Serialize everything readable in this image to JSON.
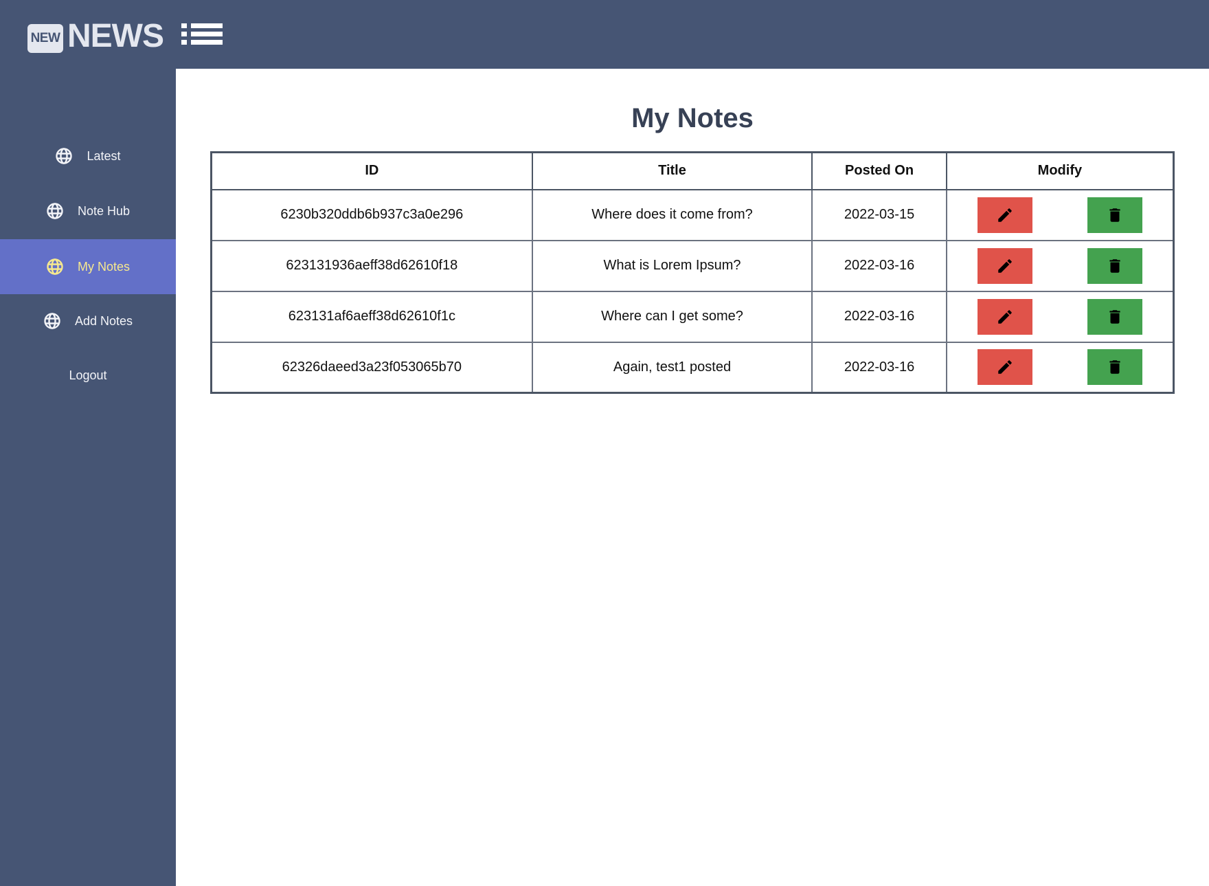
{
  "header": {
    "logo_badge": "NEW",
    "logo_text": "NEWS",
    "menu_icon": "list-menu-icon"
  },
  "sidebar": {
    "items": [
      {
        "label": "Latest",
        "icon": "globe-icon",
        "active": false
      },
      {
        "label": "Note Hub",
        "icon": "globe-icon",
        "active": false
      },
      {
        "label": "My Notes",
        "icon": "globe-icon",
        "active": true
      },
      {
        "label": "Add Notes",
        "icon": "globe-icon",
        "active": false
      },
      {
        "label": "Logout",
        "icon": null,
        "active": false
      }
    ]
  },
  "main": {
    "title": "My Notes",
    "table": {
      "headers": [
        "ID",
        "Title",
        "Posted On",
        "Modify"
      ],
      "rows": [
        {
          "id": "6230b320ddb6b937c3a0e296",
          "title": "Where does it come from?",
          "posted_on": "2022-03-15"
        },
        {
          "id": "623131936aeff38d62610f18",
          "title": "What is Lorem Ipsum?",
          "posted_on": "2022-03-16"
        },
        {
          "id": "623131af6aeff38d62610f1c",
          "title": "Where can I get some?",
          "posted_on": "2022-03-16"
        },
        {
          "id": "62326daeed3a23f053065b70",
          "title": "Again, test1 posted",
          "posted_on": "2022-03-16"
        }
      ],
      "actions": {
        "edit_icon": "pencil-icon",
        "delete_icon": "trash-icon"
      }
    }
  },
  "colors": {
    "header_bg": "#465574",
    "sidebar_bg": "#465574",
    "active_item_bg": "#6370c8",
    "active_item_text": "#f7e98e",
    "edit_button": "#e0534a",
    "delete_button": "#44a24f",
    "title_text": "#374155"
  }
}
